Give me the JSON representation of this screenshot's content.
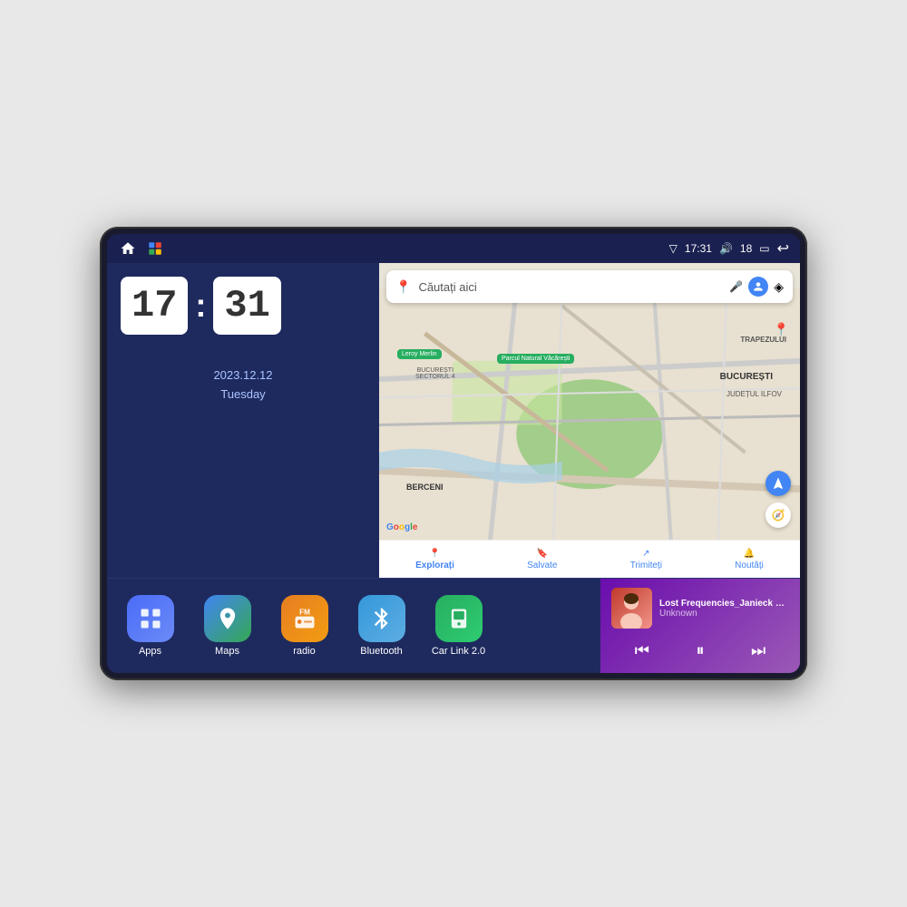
{
  "device": {
    "screen": {
      "status_bar": {
        "signal_icon": "▽",
        "time": "17:31",
        "volume_icon": "🔊",
        "battery_level": "18",
        "battery_icon": "▭",
        "back_icon": "↩",
        "home_label": "home",
        "maps_label": "maps-pin"
      },
      "clock_widget": {
        "hours": "17",
        "minutes": "31",
        "date": "2023.12.12",
        "day": "Tuesday"
      },
      "map": {
        "search_placeholder": "Căutați aici",
        "trapezului": "TRAPEZULUI",
        "bucuresti": "BUCUREȘTI",
        "judet_ilfov": "JUDEȚUL ILFOV",
        "berceni": "BERCENI",
        "sector4": "BUCUREȘTI\nSECTORUL 4",
        "leroy_merlin": "Leroy Merlin",
        "parc_natural": "Parcul Natural Văcărești",
        "nav_items": [
          {
            "label": "Explorați",
            "icon": "📍",
            "active": true
          },
          {
            "label": "Salvate",
            "icon": "🔖",
            "active": false
          },
          {
            "label": "Trimiteți",
            "icon": "↗",
            "active": false
          },
          {
            "label": "Noutăți",
            "icon": "🔔",
            "active": false
          }
        ]
      },
      "apps": [
        {
          "id": "apps",
          "label": "Apps",
          "icon": "⊞",
          "color_class": "icon-apps"
        },
        {
          "id": "maps",
          "label": "Maps",
          "icon": "🗺",
          "color_class": "icon-maps"
        },
        {
          "id": "radio",
          "label": "radio",
          "icon": "📻",
          "color_class": "icon-radio"
        },
        {
          "id": "bluetooth",
          "label": "Bluetooth",
          "icon": "⚡",
          "color_class": "icon-bluetooth"
        },
        {
          "id": "carlink",
          "label": "Car Link 2.0",
          "icon": "📱",
          "color_class": "icon-carlink"
        }
      ],
      "music_player": {
        "title": "Lost Frequencies_Janieck Devy-...",
        "artist": "Unknown",
        "prev_icon": "⏮",
        "play_pause_icon": "⏸",
        "next_icon": "⏭"
      }
    }
  }
}
